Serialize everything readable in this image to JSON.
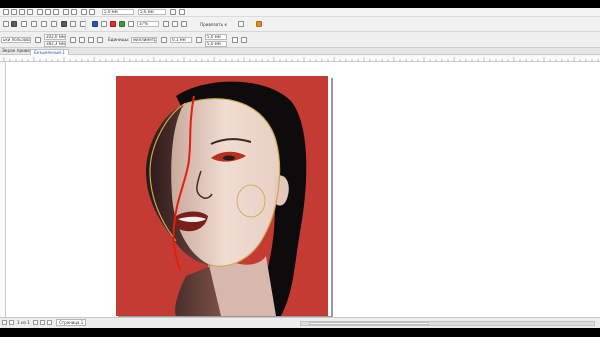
{
  "toolbar": {
    "size_fields": [
      "5,0 мм",
      "5,0 мм"
    ],
    "zoom_value": "37%",
    "snap_label": "Привязать к"
  },
  "property_bar": {
    "preset_label": "ьки пользователя",
    "x_value": "202,0 мм",
    "y_value": "382,3 мм",
    "w_value": "100,0",
    "h_value": "100,0",
    "units_label": "Единицы:",
    "units_value": "миллиметры",
    "nudge_value": "0,1 мм",
    "dup_x": "5,0 мм",
    "dup_y": "5,0 мм"
  },
  "tabs": {
    "welcome_label": "Экран приветствия",
    "doc_label": "Безымянный-1"
  },
  "status": {
    "page_count": "1 из 1",
    "page_tab": "Страница 1"
  },
  "colors": {
    "artwork_background": "#c43b33",
    "line_red": "#e02010",
    "line_outline": "#c9a84a"
  }
}
